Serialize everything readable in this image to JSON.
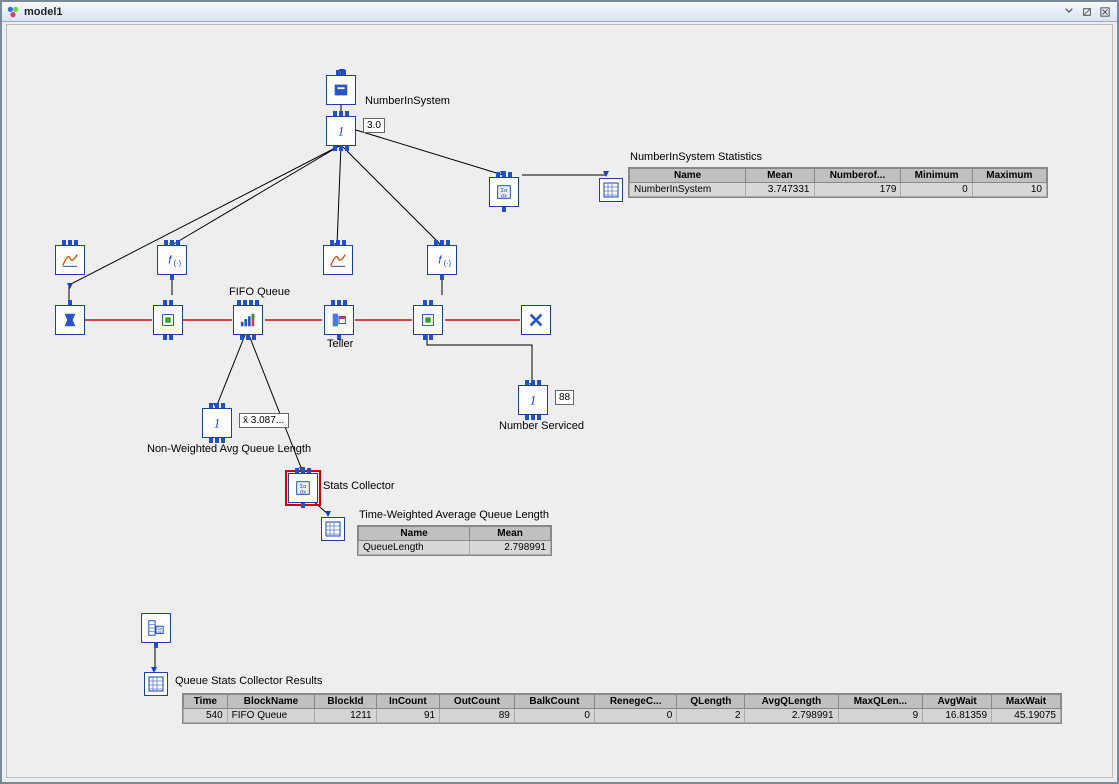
{
  "window": {
    "title": "model1"
  },
  "labels": {
    "number_in_system": "NumberInSystem",
    "nis_readout": "3.0",
    "nis_stats_title": "NumberInSystem Statistics",
    "fifo_queue": "FIFO Queue",
    "teller": "Teller",
    "number_serviced": "Number Serviced",
    "ns_readout": "88",
    "non_weighted_avg": "Non-Weighted Avg Queue Length",
    "nwavg_readout": "x̄ 3.087...",
    "stats_collector": "Stats Collector",
    "tw_avg_title": "Time-Weighted Average Queue Length",
    "queue_stats_title": "Queue Stats Collector Results"
  },
  "nis_stats": {
    "headers": [
      "Name",
      "Mean",
      "Numberof...",
      "Minimum",
      "Maximum"
    ],
    "row": {
      "name": "NumberInSystem",
      "mean": "3.747331",
      "n": "179",
      "min": "0",
      "max": "10"
    }
  },
  "tw_avg": {
    "headers": [
      "Name",
      "Mean"
    ],
    "row": {
      "name": "QueueLength",
      "mean": "2.798991"
    }
  },
  "queue_stats": {
    "headers": [
      "Time",
      "BlockName",
      "BlockId",
      "InCount",
      "OutCount",
      "BalkCount",
      "RenegeC...",
      "QLength",
      "AvgQLength",
      "MaxQLen...",
      "AvgWait",
      "MaxWait"
    ],
    "row": {
      "time": "540",
      "block": "FIFO Queue",
      "id": "1211",
      "in": "91",
      "out": "89",
      "balk": "0",
      "renege": "0",
      "qlen": "2",
      "avgq": "2.798991",
      "maxq": "9",
      "avgw": "16.81359",
      "maxw": "45.19075"
    }
  },
  "chart_data": {
    "type": "table",
    "tables": [
      {
        "title": "NumberInSystem Statistics",
        "columns": [
          "Name",
          "Mean",
          "NumberOfObs",
          "Minimum",
          "Maximum"
        ],
        "rows": [
          [
            "NumberInSystem",
            3.747331,
            179,
            0,
            10
          ]
        ]
      },
      {
        "title": "Time-Weighted Average Queue Length",
        "columns": [
          "Name",
          "Mean"
        ],
        "rows": [
          [
            "QueueLength",
            2.798991
          ]
        ]
      },
      {
        "title": "Queue Stats Collector Results",
        "columns": [
          "Time",
          "BlockName",
          "BlockId",
          "InCount",
          "OutCount",
          "BalkCount",
          "RenegeCount",
          "QLength",
          "AvgQLength",
          "MaxQLength",
          "AvgWait",
          "MaxWait"
        ],
        "rows": [
          [
            540,
            "FIFO Queue",
            1211,
            91,
            89,
            0,
            0,
            2,
            2.798991,
            9,
            16.81359,
            45.19075
          ]
        ]
      }
    ]
  }
}
